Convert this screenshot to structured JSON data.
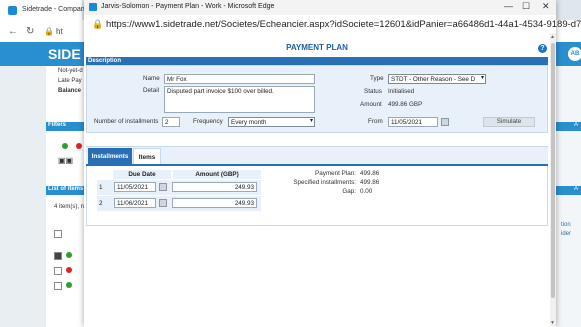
{
  "background_browser": {
    "tab_title": "Sidetrade - Company",
    "nav_back": "←",
    "nav_reload": "↻",
    "url_fragment": "ht",
    "logo": "SIDE",
    "avatar": "AB",
    "info_lines": [
      "Not-yet-d",
      "Late Pay",
      "Balance"
    ],
    "filters_label": "Filters",
    "list_label": "List of items",
    "items_count": "4 item(s), n",
    "right_text": "A",
    "right_words": [
      "tion",
      "ider"
    ]
  },
  "window": {
    "title": "Jarvis-Solomon - Payment Plan - Work - Microsoft Edge",
    "url": "https://www1.sidetrade.net/Societes/Echeancier.aspx?idSociete=12601&idPanier=a66486d1-44a1-4534-9189-d7...",
    "controls": {
      "minimize": "—",
      "maximize": "☐",
      "close": "✕"
    }
  },
  "page": {
    "title": "PAYMENT PLAN",
    "help_icon": "?",
    "description_header": "Description"
  },
  "description": {
    "name_label": "Name",
    "name_value": "Mr Fox",
    "detail_label": "Detail",
    "detail_value": "Disputed part invoice $100 over billed.",
    "type_label": "Type",
    "type_value": "STDT - Other Reason - See D",
    "status_label": "Status",
    "status_value": "Initialised",
    "amount_label": "Amount",
    "amount_value": "499.86 GBP",
    "installments_label": "Number of installments",
    "installments_value": "2",
    "frequency_label": "Frequency",
    "frequency_value": "Every month",
    "from_label": "From",
    "from_value": "11/05/2021",
    "simulate_label": "Simulate"
  },
  "tabs": [
    {
      "label": "Installments",
      "active": true
    },
    {
      "label": "Items",
      "active": false
    }
  ],
  "installments": {
    "columns": [
      "Due Date",
      "Amount (GBP)"
    ],
    "rows": [
      {
        "num": "1",
        "due_date": "11/05/2021",
        "amount": "249.93"
      },
      {
        "num": "2",
        "due_date": "11/06/2021",
        "amount": "249.93"
      }
    ],
    "summary": [
      {
        "label": "Payment Plan:",
        "value": "499.86"
      },
      {
        "label": "Specified installments:",
        "value": "499.86"
      },
      {
        "label": "Gap:",
        "value": "0.00"
      }
    ]
  },
  "colors": {
    "accent": "#2a6fb3",
    "title_blue": "#1d5fa8",
    "panel_bg": "#e8f1f9",
    "header_blue": "#2a8fcf"
  }
}
